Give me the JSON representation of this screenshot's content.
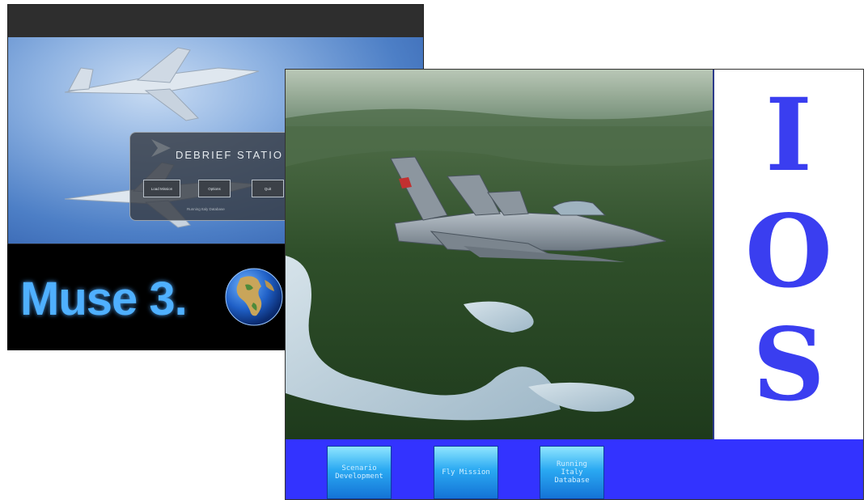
{
  "debrief": {
    "title": "DEBRIEF STATIO",
    "buttons": [
      "Load Mission",
      "Options",
      "Quit"
    ],
    "status": "Running Italy Database"
  },
  "muse": {
    "title": "Muse 3."
  },
  "ios": {
    "letters": [
      "I",
      "O",
      "S"
    ],
    "buttons": [
      "Scenario\nDevelopment",
      "Fly Mission",
      "Running\nItaly\nDatabase"
    ]
  },
  "colors": {
    "ios_bar": "#3333ff",
    "ios_letters": "#3a3ef0",
    "muse_text": "#4fb0ff"
  }
}
